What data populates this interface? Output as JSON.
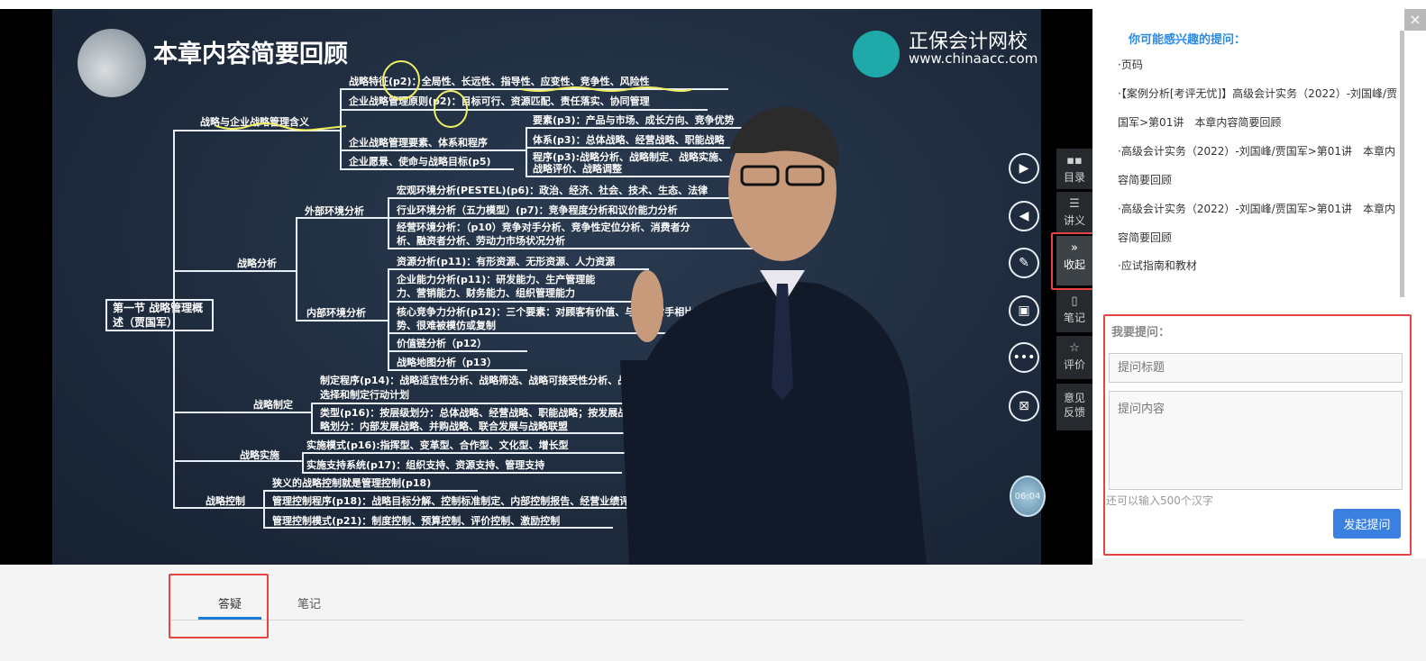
{
  "video": {
    "slide_title": "本章内容简要回顾",
    "brand_name": "正保会计网校",
    "brand_url": "www.chinaacc.com",
    "root_node": "第一节 战略管理概述（贾国军）",
    "nodes": {
      "n1": "战略与企业战略管理含义",
      "n1a": "战略特征(p2)：全局性、长远性、指导性、应变性、竞争性、风险性",
      "n1b": "企业战略管理原则(p2)：目标可行、资源匹配、责任落实、协同管理",
      "n1c": "企业战略管理要素、体系和程序",
      "n1c1": "要素(p3)：产品与市场、成长方向、竞争优势",
      "n1c2": "体系(p3)：总体战略、经营战略、职能战略",
      "n1c3a": "程序(p3):战略分析、战略制定、战略实施、",
      "n1c3b": "战略评价、战略调整",
      "n1d": "企业愿景、使命与战略目标(p5)",
      "n2": "战略分析",
      "n2a": "外部环境分析",
      "n2a1": "宏观环境分析(PESTEL)(p6)：政治、经济、社会、技术、生态、法律",
      "n2a2": "行业环境分析（五力模型）(p7)：竞争程度分析和议价能力分析",
      "n2a3a": "经营环境分析：（p10）竞争对手分析、竞争性定位分析、消费者分",
      "n2a3b": "析、融资者分析、劳动力市场状况分析",
      "n2b": "内部环境分析",
      "n2b1": "资源分析(p11)：有形资源、无形资源、人力资源",
      "n2b2a": "企业能力分析(p11)：研发能力、生产管理能",
      "n2b2b": "力、营销能力、财务能力、组织管理能力",
      "n2b3a": "核心竞争力分析(p12)：三个要素：对顾客有价值、与竞争对手相比有优",
      "n2b3b": "势、很难被模仿或复制",
      "n2b4": "价值链分析（p12）",
      "n2b5": "战略地图分析（p13）",
      "n3": "战略制定",
      "n3a1": "制定程序(p14)：战略适宜性分析、战略筛选、战略可接受性分析、战略可行性分析、",
      "n3a2": "选择和制定行动计划",
      "n3b1": "类型(p16)：按层级划分：总体战略、经营战略、职能战略；按发展战",
      "n3b2": "略划分：内部发展战略、并购战略、联合发展与战略联盟",
      "n4": "战略实施",
      "n4a": "实施模式(p16):指挥型、变革型、合作型、文化型、增长型",
      "n4b": "实施支持系统(p17)：组织支持、资源支持、管理支持",
      "n5": "战略控制",
      "n5a": "狭义的战略控制就是管理控制(p18)",
      "n5b": "管理控制程序(p18)：战略目标分解、控制标准制定、内部控制报告、经营业绩评价、管理者绩效评价",
      "n5c": "管理控制模式(p21)：制度控制、预算控制、评价控制、激励控制"
    },
    "timer": "06:04"
  },
  "toolbar": {
    "catalog": "目录",
    "handout": "讲义",
    "collapse": "收起",
    "notes": "笔记",
    "rate": "评价",
    "feedback": "意见反馈"
  },
  "panel": {
    "close": "×",
    "recommend_title": "你可能感兴趣的提问：",
    "recommend_items": [
      "·页码",
      "·【案例分析[考评无忧]】高级会计实务（2022）-刘国峰/贾国军>第01讲　本章内容简要回顾",
      "·高级会计实务（2022）-刘国峰/贾国军>第01讲　本章内容简要回顾",
      "·高级会计实务（2022）-刘国峰/贾国军>第01讲　本章内容简要回顾",
      "·应试指南和教材"
    ],
    "ask_label": "我要提问：",
    "title_placeholder": "提问标题",
    "body_placeholder": "提问内容",
    "char_remaining": "还可以输入500个汉字",
    "submit": "发起提问"
  },
  "tabs": {
    "qa": "答疑",
    "notes": "笔记"
  },
  "colors": {
    "accent": "#3a80e0",
    "highlight_red": "#e84343",
    "link_blue": "#2a8ce6"
  }
}
